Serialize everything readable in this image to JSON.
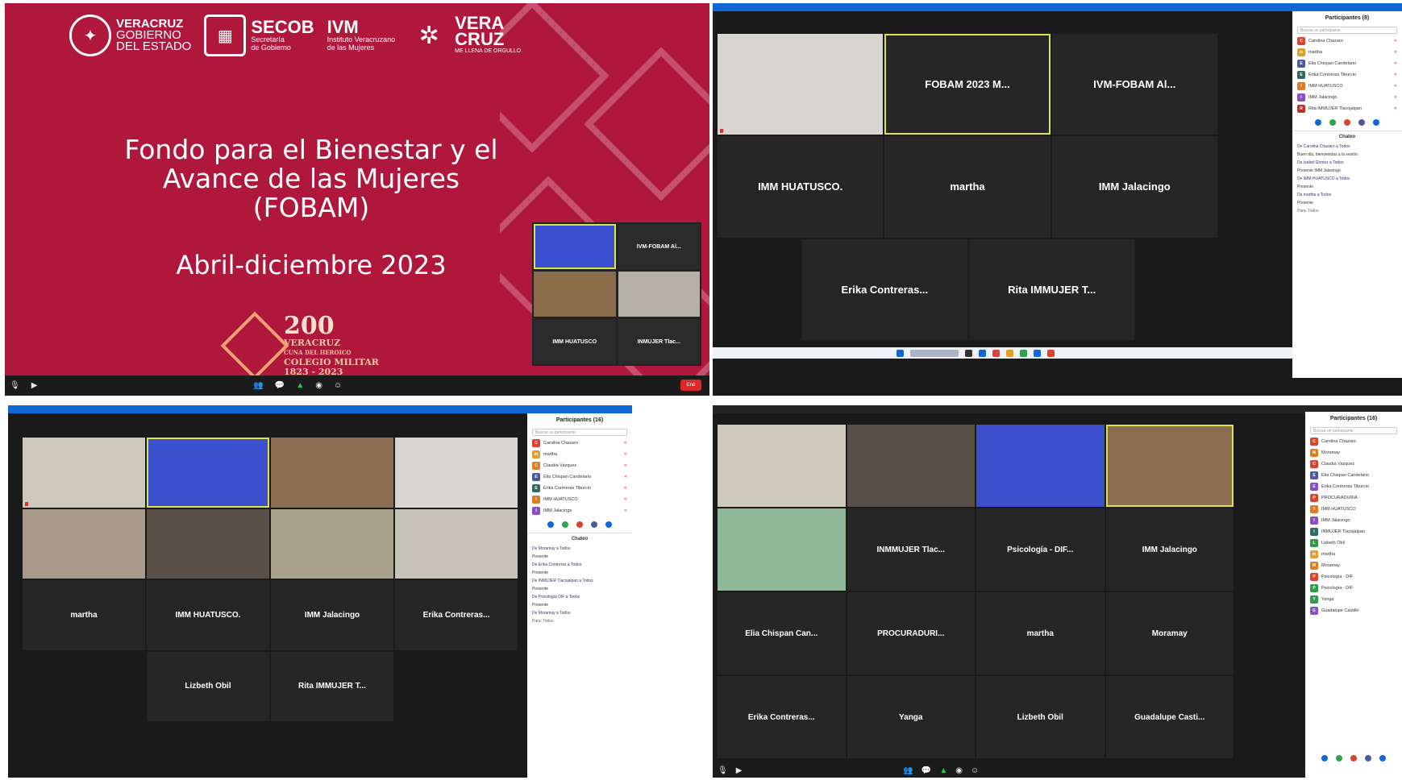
{
  "slide": {
    "title_lines": [
      "Fondo para el Bienestar y el",
      "Avance de las Mujeres",
      "(FOBAM)"
    ],
    "date": "Abril-diciembre 2023",
    "logos": {
      "veracruz_1": "VERACRUZ",
      "veracruz_2": "GOBIERNO",
      "veracruz_3": "DEL ESTADO",
      "secob": "SECOB",
      "secob_sub_1": "Secretaría",
      "secob_sub_2": "de Gobierno",
      "ivm": "IVM",
      "ivm_sub_1": "Instituto Veracruzano",
      "ivm_sub_2": "de las Mujeres",
      "vera_1": "VERA",
      "vera_2": "CRUZ",
      "vera_sub": "ME LLENA DE ORGULLO"
    },
    "badge": {
      "number": "200",
      "line1": "VERACRUZ",
      "line2": "CUNA DEL HEROICO",
      "line3": "COLEGIO MILITAR",
      "line4": "1823 - 2023"
    },
    "mini_tiles": [
      "",
      "IVM-FOBAM Al...",
      "",
      "",
      "IMM HUATUSCO",
      "INMUJER Tlac..."
    ],
    "end_label": "End"
  },
  "q2": {
    "tiles": [
      "",
      "FOBAM 2023 M...",
      "IVM-FOBAM Al...",
      "IMM HUATUSCO.",
      "martha",
      "IMM Jalacingo",
      "Erika Contreras...",
      "Rita IMMUJER T..."
    ],
    "panel_title": "Participantes (8)",
    "search": "Buscar un participante",
    "participants": [
      {
        "initial": "C",
        "name": "Carolina Chazaro",
        "color": "#d9432f"
      },
      {
        "initial": "m",
        "name": "martha",
        "color": "#e0a030"
      },
      {
        "initial": "E",
        "name": "Elia Chispan Candelario",
        "color": "#4b5a9c"
      },
      {
        "initial": "E",
        "name": "Erika Contreras Tiburcio",
        "color": "#2e6b63"
      },
      {
        "initial": "I",
        "name": "IMM HUATUSCO",
        "color": "#e07b28"
      },
      {
        "initial": "I",
        "name": "IMM Jalacingo",
        "color": "#8a4fc4"
      },
      {
        "initial": "R",
        "name": "Rita IMMUJER Tlacojalpan",
        "color": "#c42d2d"
      }
    ],
    "chat_title": "Chateo",
    "chat_lines": [
      "De Carolina Chazaro a Todos",
      "Buen día, bienvenidas a la sesión",
      "De Isabel Gómez a Todos",
      "Presente IMM Jalacingo",
      "De IMM HUATUSCO a Todos",
      "Presente",
      "De martha a Todos",
      "Presente",
      "Para: Todos"
    ]
  },
  "q3": {
    "tiles": [
      "",
      "",
      "",
      "",
      "",
      "",
      "",
      "",
      "martha",
      "IMM HUATUSCO.",
      "IMM Jalacingo",
      "Erika Contreras...",
      "",
      "Lizbeth Obil",
      "Rita IMMUJER T..."
    ],
    "panel_title": "Participantes (16)",
    "search": "Buscar un participante",
    "participants": [
      {
        "initial": "C",
        "name": "Carolina Chazaro",
        "color": "#d9432f"
      },
      {
        "initial": "m",
        "name": "martha",
        "color": "#e0a030"
      },
      {
        "initial": "C",
        "name": "Claudia Vazquez",
        "color": "#e07b28"
      },
      {
        "initial": "E",
        "name": "Elia Chispan Candelario",
        "color": "#4b5a9c"
      },
      {
        "initial": "E",
        "name": "Erika Contreras Tiburcio",
        "color": "#2e6b63"
      },
      {
        "initial": "I",
        "name": "IMM HUATUSCO",
        "color": "#e07b28"
      },
      {
        "initial": "I",
        "name": "IMM Jalacingo",
        "color": "#8a4fc4"
      }
    ],
    "chat_title": "Chateo",
    "chat_lines": [
      "De Moramay a Todos",
      "Presente",
      "De Erika Contreras a Todos",
      "Presente",
      "De INMUJER Tlacojalpan a Todos",
      "Presente",
      "De Psicología DIF a Todos",
      "Presente",
      "De Moramay a Todos",
      "Para: Todos"
    ]
  },
  "q4": {
    "tiles": [
      "",
      "",
      "",
      "",
      "",
      "INMMUJER Tlac...",
      "Psicología - DIF...",
      "IMM Jalacingo",
      "Elia Chispan Can...",
      "PROCURADURI...",
      "martha",
      "Moramay",
      "Erika Contreras...",
      "Yanga",
      "Lizbeth Obil",
      "Guadalupe Casti..."
    ],
    "panel_title": "Participantes (16)",
    "search": "Buscar un participante",
    "participants": [
      {
        "initial": "C",
        "name": "Carolina Chazaro",
        "color": "#d9432f"
      },
      {
        "initial": "M",
        "name": "Moramay",
        "color": "#e07b28"
      },
      {
        "initial": "C",
        "name": "Claudia Vazquez",
        "color": "#d9432f"
      },
      {
        "initial": "E",
        "name": "Elia Chispan Candelario",
        "color": "#4b5a9c"
      },
      {
        "initial": "E",
        "name": "Erika Contreras Tiburcio",
        "color": "#8a4fc4"
      },
      {
        "initial": "P",
        "name": "PROCURADURIA",
        "color": "#d9432f"
      },
      {
        "initial": "I",
        "name": "IMM HUATUSCO",
        "color": "#e07b28"
      },
      {
        "initial": "I",
        "name": "IMM Jalacingo",
        "color": "#8a4fc4"
      },
      {
        "initial": "I",
        "name": "INMUJER Tlacojalpan",
        "color": "#2e6b63"
      },
      {
        "initial": "L",
        "name": "Lizbeth Obil",
        "color": "#2e9a4a"
      },
      {
        "initial": "m",
        "name": "martha",
        "color": "#e0a030"
      },
      {
        "initial": "M",
        "name": "Moramay",
        "color": "#e07b28"
      },
      {
        "initial": "P",
        "name": "Psicología - DIF",
        "color": "#d9432f"
      },
      {
        "initial": "P",
        "name": "Psicología - DIF",
        "color": "#2e9a4a"
      },
      {
        "initial": "Y",
        "name": "Yanga",
        "color": "#2e9a4a"
      },
      {
        "initial": "G",
        "name": "Guadalupe Castillo",
        "color": "#8a4fc4"
      }
    ]
  },
  "colors": {
    "slide_bg": "#b0173c",
    "zoom_blue": "#1166d6",
    "active_speaker": "#d9e44a",
    "tile_bg": "#262626"
  }
}
